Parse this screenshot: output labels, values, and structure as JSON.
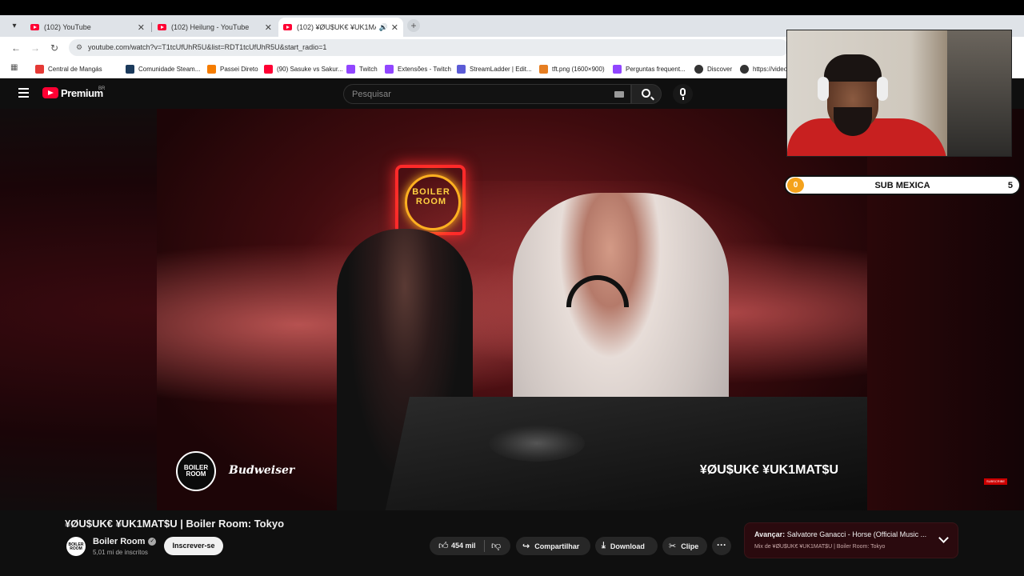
{
  "browser": {
    "tabs": [
      {
        "label": "(102) YouTube",
        "active": false
      },
      {
        "label": "(102) Heilung - YouTube",
        "active": false
      },
      {
        "label": "(102) ¥ØU$UK€ ¥UK1MAT$",
        "active": true
      }
    ],
    "url": "youtube.com/watch?v=T1tcUfUhR5U&list=RDT1tcUfUhR5U&start_radio=1",
    "bookmarks": [
      {
        "label": "Central de Mangás",
        "color": "#e53935"
      },
      {
        "label": "Comunidade Steam...",
        "color": "#1b3a5c"
      },
      {
        "label": "Passei Direto",
        "color": "#f57c00"
      },
      {
        "label": "(90) Sasuke vs Sakur...",
        "color": "#ff0033"
      },
      {
        "label": "Twitch",
        "color": "#9146ff"
      },
      {
        "label": "Extensões - Twitch",
        "color": "#9146ff"
      },
      {
        "label": "StreamLadder | Edit...",
        "color": "#5b5bd6"
      },
      {
        "label": "tft.png (1600×900)",
        "color": "#e67e22"
      },
      {
        "label": "Perguntas frequent...",
        "color": "#9146ff"
      },
      {
        "label": "Discover",
        "color": "#333333"
      },
      {
        "label": "https://video",
        "color": "#333333"
      }
    ]
  },
  "youtube": {
    "brand": "Premium",
    "region": "BR",
    "search_placeholder": "Pesquisar"
  },
  "video": {
    "overlay_title": "¥ØU$UK€ ¥UK1MAT$U",
    "sign_text": "BOILER ROOM",
    "logo_text": "BOILER ROOM",
    "sponsor": "Budweiser",
    "subscribe_tag": "SUBSCRIBE"
  },
  "prediction": {
    "left_value": "0",
    "title": "SUB MEXICA",
    "right_value": "5"
  },
  "info": {
    "title": "¥ØU$UK€ ¥UK1MAT$U | Boiler Room: Tokyo",
    "channel": "Boiler Room",
    "channel_avatar_text": "BOILER ROOM",
    "subscribers": "5,01 mi de inscritos",
    "subscribe_label": "Inscrever-se",
    "likes": "454 mil",
    "share_label": "Compartilhar",
    "download_label": "Download",
    "clip_label": "Clipe",
    "upnext_prefix": "Avançar:",
    "upnext_title": "Salvatore Ganacci - Horse (Official Music ...",
    "upnext_mix": "Mix de ¥ØU$UK€ ¥UK1MAT$U | Boiler Room: Tokyo"
  }
}
